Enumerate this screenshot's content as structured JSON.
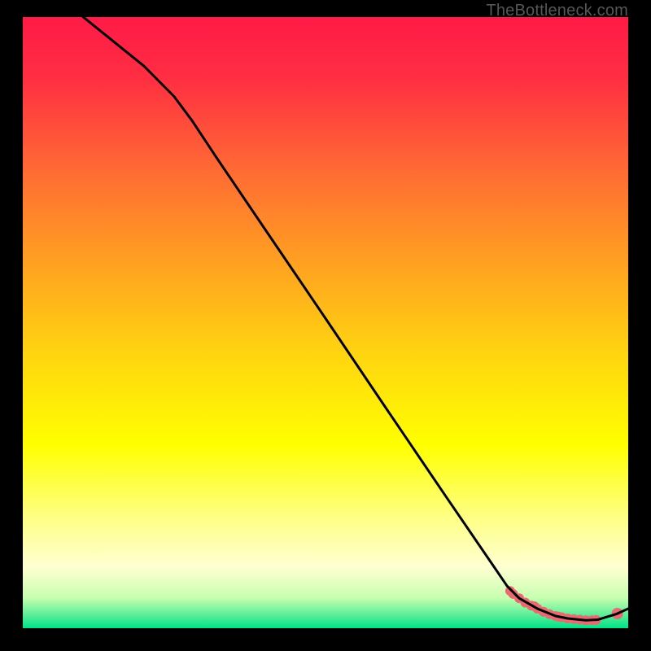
{
  "watermark": "TheBottleneck.com",
  "chart_data": {
    "type": "line",
    "title": "",
    "xlabel": "",
    "ylabel": "",
    "xlim": [
      0,
      100
    ],
    "ylim": [
      0,
      100
    ],
    "grid": false,
    "background_gradient": {
      "stops": [
        {
          "offset": 0.0,
          "color": "#ff1a47"
        },
        {
          "offset": 0.1,
          "color": "#ff2e42"
        },
        {
          "offset": 0.25,
          "color": "#ff6a34"
        },
        {
          "offset": 0.4,
          "color": "#ffa021"
        },
        {
          "offset": 0.55,
          "color": "#ffd410"
        },
        {
          "offset": 0.7,
          "color": "#ffff00"
        },
        {
          "offset": 0.82,
          "color": "#feff85"
        },
        {
          "offset": 0.9,
          "color": "#ffffd2"
        },
        {
          "offset": 0.95,
          "color": "#c8ffb0"
        },
        {
          "offset": 0.975,
          "color": "#67f09a"
        },
        {
          "offset": 1.0,
          "color": "#00e288"
        }
      ]
    },
    "series": [
      {
        "name": "main-curve",
        "color": "#000000",
        "x": [
          0,
          5,
          10,
          15,
          20,
          25,
          28,
          32,
          40,
          50,
          60,
          70,
          78,
          80,
          82,
          85,
          88,
          90,
          93,
          95,
          98,
          100
        ],
        "y": [
          108,
          104,
          100,
          96,
          92,
          87,
          83,
          77,
          65.3,
          50.7,
          36,
          21.4,
          9.8,
          6.9,
          4.9,
          3.2,
          2.0,
          1.6,
          1.3,
          1.4,
          2.3,
          3.2
        ]
      }
    ],
    "markers": [
      {
        "name": "highlight-band",
        "color": "#eb6a72",
        "x": [
          80.5,
          81,
          82,
          83,
          84,
          84.5,
          85,
          86,
          87,
          88,
          88.5,
          89,
          90,
          91,
          92,
          93,
          94,
          94.7
        ],
        "y": [
          6.1,
          5.6,
          4.9,
          4.2,
          3.7,
          3.6,
          3.2,
          2.7,
          2.3,
          2.0,
          1.9,
          1.8,
          1.6,
          1.5,
          1.4,
          1.3,
          1.3,
          1.35
        ]
      },
      {
        "name": "highlight-point",
        "color": "#eb6a72",
        "x": [
          98.2
        ],
        "y": [
          2.4
        ]
      }
    ]
  }
}
